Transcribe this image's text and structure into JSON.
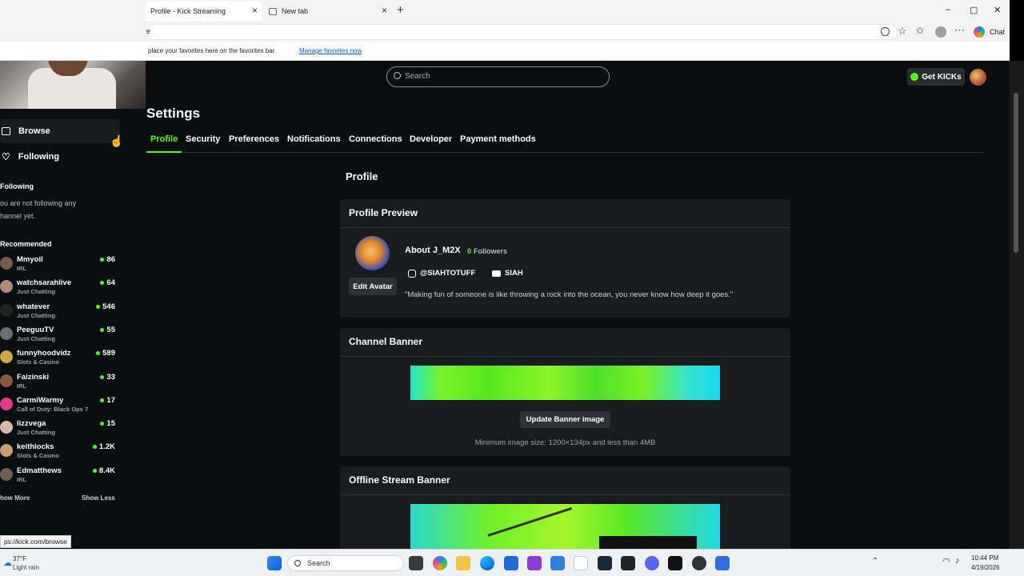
{
  "browser": {
    "tabs": [
      {
        "title": "Profile - Kick Streaming",
        "active": true
      },
      {
        "title": "New tab",
        "active": false
      }
    ],
    "new_tab_symbol": "+",
    "close_symbol": "×",
    "address_fragment": "e",
    "favorites_text": "place your favorites here on the favorites bar.",
    "favorites_link": "Manage favorites now",
    "chat_label": "Chat",
    "window_controls": [
      "–",
      "▢",
      "✕"
    ],
    "status_url": "ps://kick.com/browse"
  },
  "header": {
    "search_placeholder": "Search",
    "get_kicks_label": "Get KICKs"
  },
  "sidebar": {
    "nav": [
      {
        "label": "Browse",
        "icon": "browse-icon"
      },
      {
        "label": "Following",
        "icon": "heart-icon"
      }
    ],
    "following_heading": "Following",
    "following_empty": [
      "ou are not following any",
      "hannel yet."
    ],
    "recommended_heading": "Recommended",
    "recommended": [
      {
        "name": "Mmyoil",
        "category": "IRL",
        "viewers": "86",
        "color": "#7a5a48"
      },
      {
        "name": "watchsarahlive",
        "category": "Just Chatting",
        "viewers": "64",
        "color": "#b08a78"
      },
      {
        "name": "whatever",
        "category": "Just Chatting",
        "viewers": "546",
        "color": "#222222"
      },
      {
        "name": "PeeguuTV",
        "category": "Just Chatting",
        "viewers": "55",
        "color": "#6a6e72"
      },
      {
        "name": "funnyhoodvidz",
        "category": "Slots & Casino",
        "viewers": "589",
        "color": "#c9a84a"
      },
      {
        "name": "Faizinski",
        "category": "IRL",
        "viewers": "33",
        "color": "#8a5a3a"
      },
      {
        "name": "CarmiWarmy",
        "category": "Call of Duty: Black Ops 7",
        "viewers": "17",
        "color": "#e23b8c"
      },
      {
        "name": "lizzvega",
        "category": "Just Chatting",
        "viewers": "15",
        "color": "#d8b8a8"
      },
      {
        "name": "keithlocks",
        "category": "Slots & Casino",
        "viewers": "1.2K",
        "color": "#c8a070"
      },
      {
        "name": "Edmatthews",
        "category": "IRL",
        "viewers": "8.4K",
        "color": "#6a6058"
      }
    ],
    "show_more": "how More",
    "show_less": "Show Less"
  },
  "settings": {
    "title": "Settings",
    "tabs": [
      "Profile",
      "Security",
      "Preferences",
      "Notifications",
      "Connections",
      "Developer",
      "Payment methods"
    ],
    "active_tab": "Profile",
    "section_title": "Profile",
    "preview": {
      "heading": "Profile Preview",
      "about": "About J_M2X",
      "followers_count": "0",
      "followers_label": "Followers",
      "instagram": "@SIAHTOTUFF",
      "youtube": "SIAH",
      "edit_avatar": "Edit Avatar",
      "bio": "\"Making fun of someone is like throwing a rock into the ocean, you never know how deep it goes.\""
    },
    "banner": {
      "heading": "Channel Banner",
      "update_button": "Update Banner image",
      "hint": "Minimum image size: 1200×134px and less than 4MB"
    },
    "offline": {
      "heading": "Offline Stream Banner"
    }
  },
  "taskbar": {
    "weather_temp": "37°F",
    "weather_desc": "Light rain",
    "search_placeholder": "Search",
    "time": "10:44 PM",
    "date": "4/19/2026"
  },
  "colors": {
    "accent": "#53fc18",
    "page_bg": "#0b0e0f",
    "card_bg": "#191b1d"
  }
}
